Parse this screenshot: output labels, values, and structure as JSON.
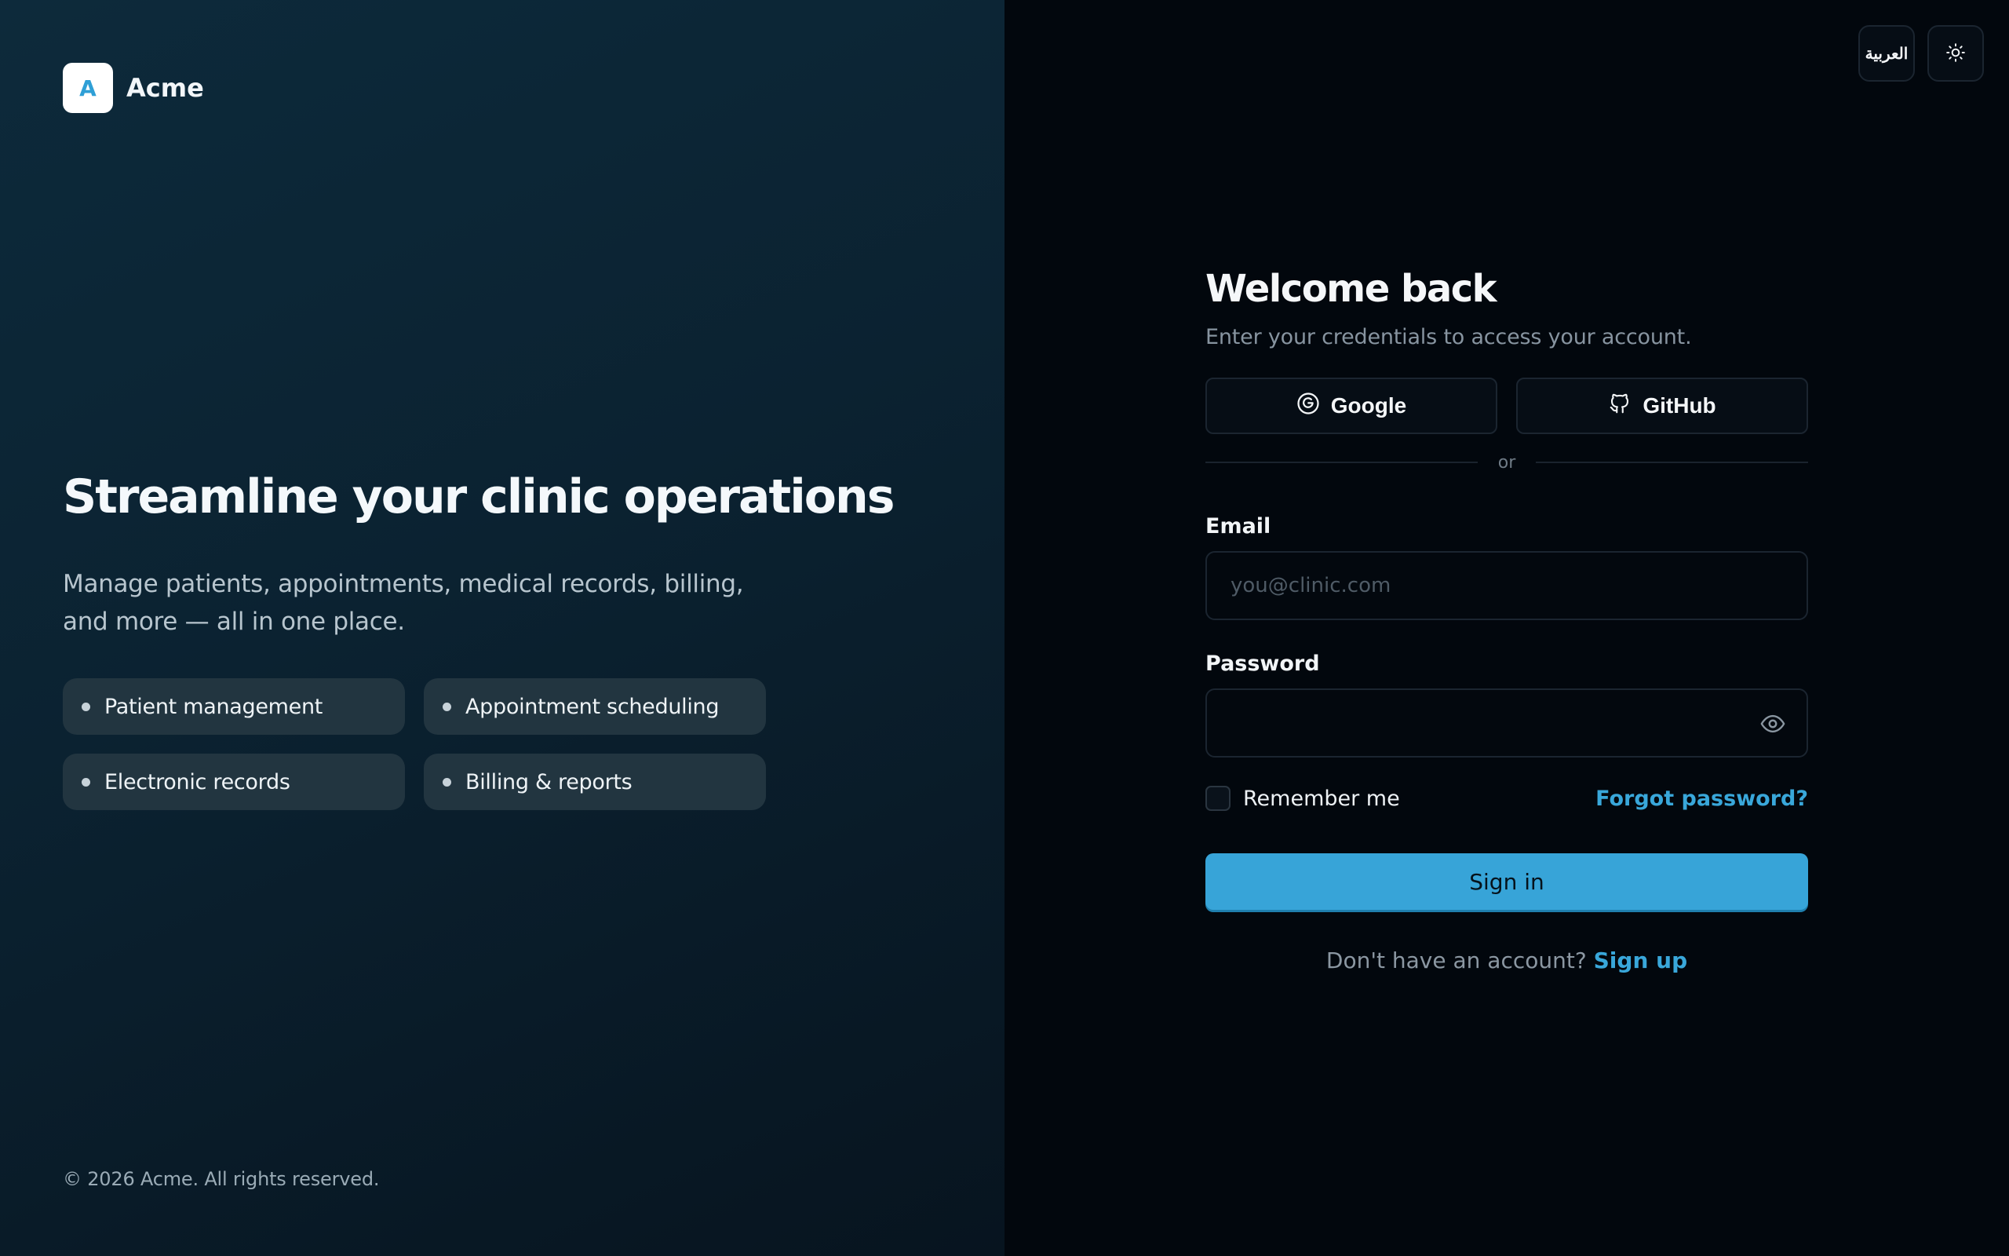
{
  "brand": {
    "logo_letter": "A",
    "name": "Acme"
  },
  "hero": {
    "title": "Streamline your clinic operations",
    "description": "Manage patients, appointments, medical records, billing, and more — all in one place."
  },
  "features": [
    {
      "label": "Patient management"
    },
    {
      "label": "Appointment scheduling"
    },
    {
      "label": "Electronic records"
    },
    {
      "label": "Billing & reports"
    }
  ],
  "footer": {
    "copyright": "© 2026 Acme. All rights reserved."
  },
  "top_bar": {
    "language_label": "العربية",
    "theme_icon": "sun-icon"
  },
  "form": {
    "title": "Welcome back",
    "subtitle": "Enter your credentials to access your account.",
    "oauth": {
      "google_label": "Google",
      "github_label": "GitHub"
    },
    "divider_text": "or",
    "email": {
      "label": "Email",
      "placeholder": "you@clinic.com",
      "value": ""
    },
    "password": {
      "label": "Password",
      "value": ""
    },
    "remember_label": "Remember me",
    "forgot_label": "Forgot password?",
    "submit_label": "Sign in",
    "signup_prompt": "Don't have an account?",
    "signup_label": "Sign up"
  },
  "colors": {
    "accent": "#37a4d8",
    "left_panel_bg": "#0b2231",
    "right_panel_bg": "#02070d",
    "feature_chip_bg": "#223540"
  }
}
